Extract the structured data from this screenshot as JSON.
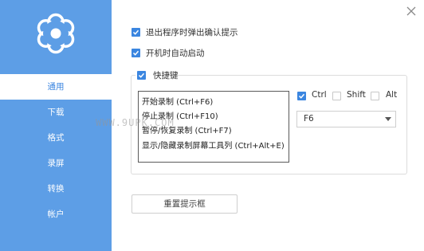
{
  "sidebar": {
    "logo_icon": "flower-gear-icon",
    "items": [
      {
        "label": "通用",
        "active": true
      },
      {
        "label": "下载",
        "active": false
      },
      {
        "label": "格式",
        "active": false
      },
      {
        "label": "录屏",
        "active": false
      },
      {
        "label": "转换",
        "active": false
      },
      {
        "label": "帐户",
        "active": false
      }
    ]
  },
  "window": {
    "close_icon": "close-icon"
  },
  "general": {
    "confirm_on_exit": {
      "label": "退出程序时弹出确认提示",
      "checked": true
    },
    "autostart": {
      "label": "开机时自动启动",
      "checked": true
    }
  },
  "hotkeys": {
    "title": "快捷键",
    "enabled": true,
    "actions": [
      "开始录制 (Ctrl+F6)",
      "停止录制 (Ctrl+F10)",
      "暂停/恢复录制 (Ctrl+F7)",
      "显示/隐藏录制屏幕工具列 (Ctrl+Alt+E)"
    ],
    "modifiers": {
      "ctrl": {
        "label": "Ctrl",
        "checked": true
      },
      "shift": {
        "label": "Shift",
        "checked": false
      },
      "alt": {
        "label": "Alt",
        "checked": false
      }
    },
    "key": {
      "value": "F6"
    }
  },
  "reset_button": {
    "label": "重置提示框"
  },
  "watermark": "WWW.9UPK.COM",
  "colors": {
    "sidebar": "#5d9ee6",
    "accent": "#3b86e0"
  }
}
